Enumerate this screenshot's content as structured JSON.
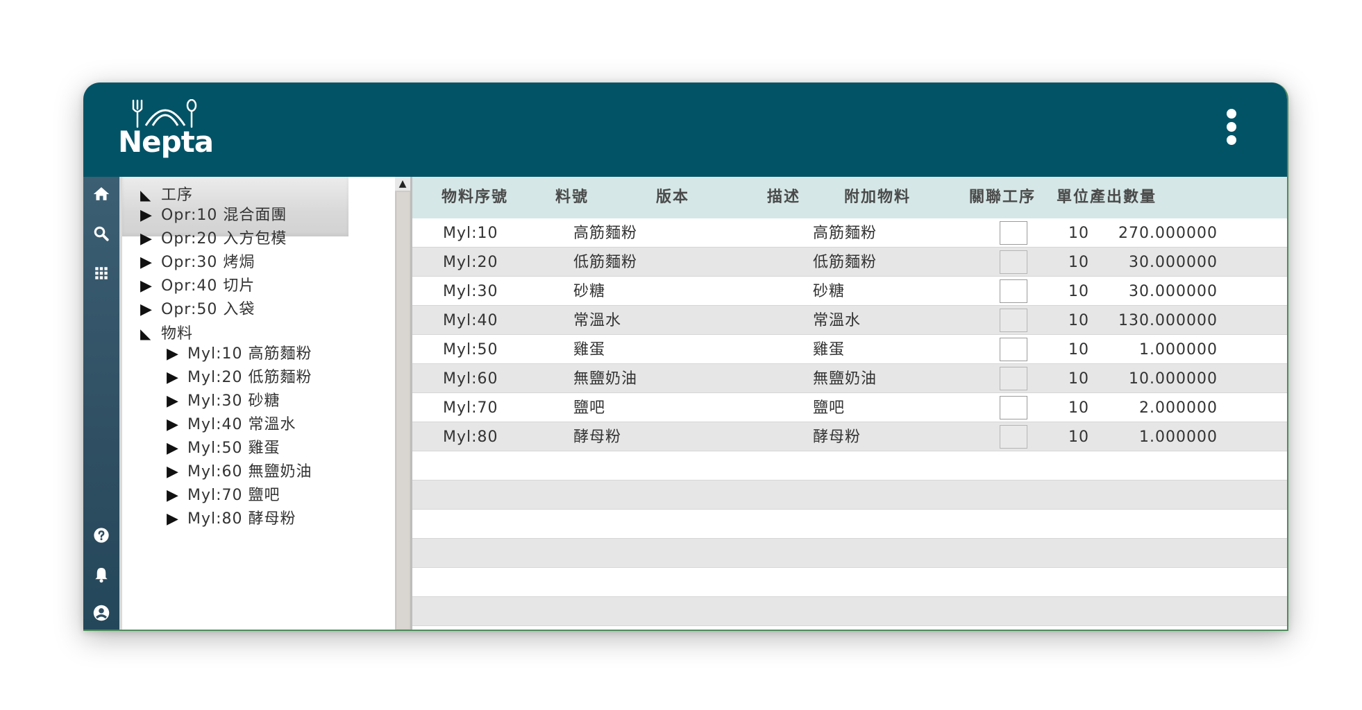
{
  "header": {
    "logo_text": "Nepta"
  },
  "rail": {
    "top_icons": [
      "home-icon",
      "search-icon",
      "apps-grid-icon"
    ],
    "bottom_icons": [
      "help-icon",
      "bell-icon",
      "account-icon"
    ]
  },
  "tree": {
    "items": [
      {
        "label": "工序",
        "expanded": true,
        "level": 0
      },
      {
        "label": "Opr:10 混合面團",
        "expanded": false,
        "level": 0,
        "selected": true
      },
      {
        "label": "Opr:20 入方包模",
        "expanded": false,
        "level": 0
      },
      {
        "label": "Opr:30 烤焗",
        "expanded": false,
        "level": 0
      },
      {
        "label": "Opr:40 切片",
        "expanded": false,
        "level": 0
      },
      {
        "label": "Opr:50 入袋",
        "expanded": false,
        "level": 0
      },
      {
        "label": "物料",
        "expanded": true,
        "level": 0
      },
      {
        "label": "Myl:10 高筋麵粉",
        "expanded": false,
        "level": 1
      },
      {
        "label": "Myl:20 低筋麵粉",
        "expanded": false,
        "level": 1
      },
      {
        "label": "Myl:30 砂糖",
        "expanded": false,
        "level": 1
      },
      {
        "label": "Myl:40 常溫水",
        "expanded": false,
        "level": 1
      },
      {
        "label": "Myl:50 雞蛋",
        "expanded": false,
        "level": 1
      },
      {
        "label": "Myl:60 無鹽奶油",
        "expanded": false,
        "level": 1
      },
      {
        "label": "Myl:70 鹽吧",
        "expanded": false,
        "level": 1
      },
      {
        "label": "Myl:80 酵母粉",
        "expanded": false,
        "level": 1
      }
    ]
  },
  "table": {
    "columns": [
      "物料序號",
      "料號",
      "版本",
      "描述",
      "附加物料",
      "關聯工序",
      "單位產出數量"
    ],
    "rows": [
      {
        "seq": "Myl:10",
        "part": "高筋麵粉",
        "version": "",
        "desc": "高筋麵粉",
        "extra": false,
        "op": "10",
        "qty": "270.000000"
      },
      {
        "seq": "Myl:20",
        "part": "低筋麵粉",
        "version": "",
        "desc": "低筋麵粉",
        "extra": false,
        "op": "10",
        "qty": "30.000000"
      },
      {
        "seq": "Myl:30",
        "part": "砂糖",
        "version": "",
        "desc": "砂糖",
        "extra": false,
        "op": "10",
        "qty": "30.000000"
      },
      {
        "seq": "Myl:40",
        "part": "常溫水",
        "version": "",
        "desc": "常溫水",
        "extra": false,
        "op": "10",
        "qty": "130.000000"
      },
      {
        "seq": "Myl:50",
        "part": "雞蛋",
        "version": "",
        "desc": "雞蛋",
        "extra": false,
        "op": "10",
        "qty": "1.000000"
      },
      {
        "seq": "Myl:60",
        "part": "無鹽奶油",
        "version": "",
        "desc": "無鹽奶油",
        "extra": false,
        "op": "10",
        "qty": "10.000000"
      },
      {
        "seq": "Myl:70",
        "part": "鹽吧",
        "version": "",
        "desc": "鹽吧",
        "extra": false,
        "op": "10",
        "qty": "2.000000"
      },
      {
        "seq": "Myl:80",
        "part": "酵母粉",
        "version": "",
        "desc": "酵母粉",
        "extra": false,
        "op": "10",
        "qty": "1.000000"
      }
    ],
    "empty_rows": 6
  },
  "colors": {
    "header_bg": "#035366",
    "table_header_bg": "#d5e7e6",
    "row_alt_bg": "#e6e6e6"
  }
}
